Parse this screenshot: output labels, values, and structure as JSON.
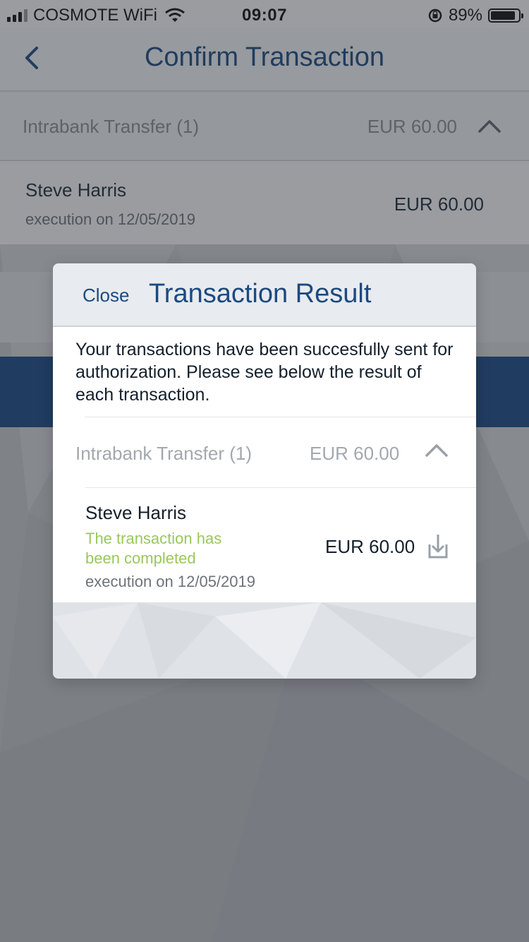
{
  "status_bar": {
    "carrier": "COSMOTE WiFi",
    "time": "09:07",
    "battery_percent": "89%",
    "battery_level": 0.89
  },
  "nav": {
    "title": "Confirm Transaction",
    "back_icon": "chevron-left-icon"
  },
  "group": {
    "title": "Intrabank Transfer (1)",
    "amount": "EUR 60.00",
    "chevron_icon": "chevron-up-icon"
  },
  "transaction": {
    "name": "Steve Harris",
    "execution": "execution on 12/05/2019",
    "amount": "EUR 60.00"
  },
  "modal": {
    "close_label": "Close",
    "title": "Transaction Result",
    "message": "Your transactions have been succesfully sent for authorization. Please see below the result of each transaction.",
    "group": {
      "title": "Intrabank Transfer (1)",
      "amount": "EUR 60.00",
      "chevron_icon": "chevron-up-icon"
    },
    "result": {
      "name": "Steve Harris",
      "status": "The transaction has been completed",
      "execution": "execution on 12/05/2019",
      "amount": "EUR 60.00",
      "download_icon": "download-icon"
    }
  },
  "colors": {
    "title_blue": "#1c4a80",
    "band_blue": "#1a4a86",
    "success_green": "#9ac85a"
  }
}
